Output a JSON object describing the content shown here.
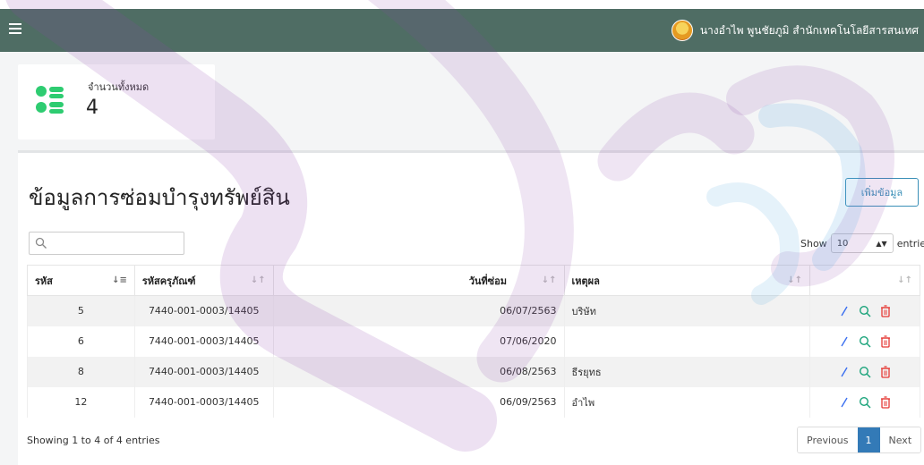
{
  "header": {
    "user_name": "นางอำไพ พูนชัยภูมิ สำนักเทคโนโลยีสารสนเทศ"
  },
  "stat": {
    "label": "จำนวนทั้งหมด",
    "value": "4"
  },
  "page": {
    "title": "ข้อมูลการซ่อมบำรุงทรัพย์สิน",
    "add_button": "เพิ่มข้อมูล"
  },
  "search": {
    "placeholder": "",
    "value": ""
  },
  "length": {
    "show": "Show",
    "value": "10",
    "entries": "entries"
  },
  "table": {
    "headers": [
      "รหัส",
      "รหัสครุภัณฑ์",
      "วันที่ซ่อม",
      "เหตุผล",
      ""
    ],
    "rows": [
      [
        "5",
        "7440-001-0003/14405",
        "06/07/2563",
        "บริษัท"
      ],
      [
        "6",
        "7440-001-0003/14405",
        "07/06/2020",
        ""
      ],
      [
        "8",
        "7440-001-0003/14405",
        "06/08/2563",
        "ธีรยุทธ"
      ],
      [
        "12",
        "7440-001-0003/14405",
        "06/09/2563",
        "อำไพ"
      ]
    ]
  },
  "footer": {
    "info": "Showing 1 to 4 of 4 entries"
  },
  "pagination": {
    "previous": "Previous",
    "page": "1",
    "next": "Next"
  },
  "icons": {
    "menu": "hamburger-icon",
    "search": "search-icon",
    "stat": "list-icon",
    "edit": "pencil-icon",
    "view": "magnifier-icon",
    "delete": "trash-icon"
  },
  "colors": {
    "topbar": "#4f6d64",
    "stat_icon": "#2ecc71",
    "accent": "#337ab7",
    "edit": "#3a6ff0",
    "view": "#1aa37a",
    "delete": "#e53935"
  }
}
